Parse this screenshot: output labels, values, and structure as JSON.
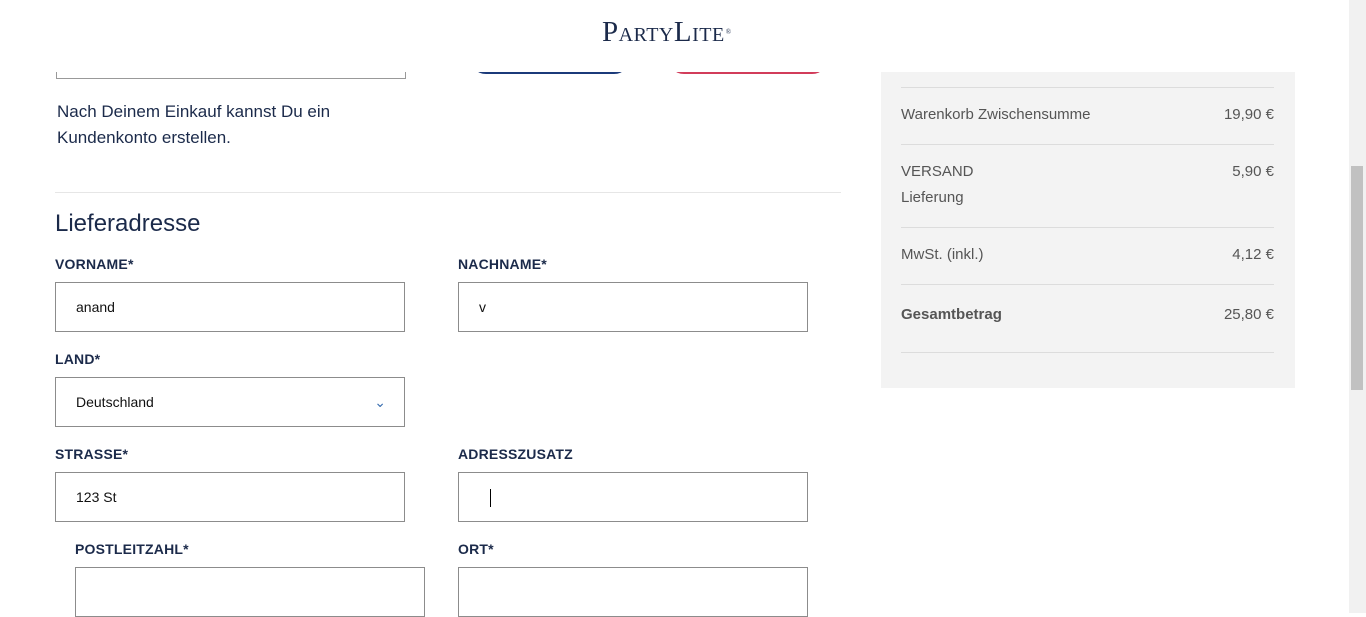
{
  "header": {
    "logo_text": "PartyLite",
    "logo_mark": "®"
  },
  "account_info": {
    "text": "Nach Deinem Einkauf kannst Du ein Kundenkonto erstellen."
  },
  "shipping": {
    "title": "Lieferadresse",
    "first_name": {
      "label": "VORNAME*",
      "value": "anand"
    },
    "last_name": {
      "label": "NACHNAME*",
      "value": "v"
    },
    "country": {
      "label": "LAND*",
      "value": "Deutschland"
    },
    "street": {
      "label": "STRASSE*",
      "value": "123 St"
    },
    "address_extra": {
      "label": "ADRESSZUSATZ",
      "value": ""
    },
    "postcode": {
      "label": "POSTLEITZAHL*",
      "value": ""
    },
    "city": {
      "label": "ORT*",
      "value": ""
    }
  },
  "summary": {
    "subtotal": {
      "label": "Warenkorb Zwischensumme",
      "value": "19,90 €"
    },
    "shipping": {
      "label": "VERSAND",
      "sublabel": "Lieferung",
      "value": "5,90 €"
    },
    "vat": {
      "label": "MwSt. (inkl.)",
      "value": "4,12 €"
    },
    "total": {
      "label": "Gesamtbetrag",
      "value": "25,80 €"
    }
  },
  "icons": {
    "dropdown": "chevron-down-icon"
  },
  "colors": {
    "brand_navy": "#1b2a4a",
    "button_blue": "#1b3a7a",
    "button_red": "#d23c5a",
    "summary_bg": "#f3f3f3"
  }
}
